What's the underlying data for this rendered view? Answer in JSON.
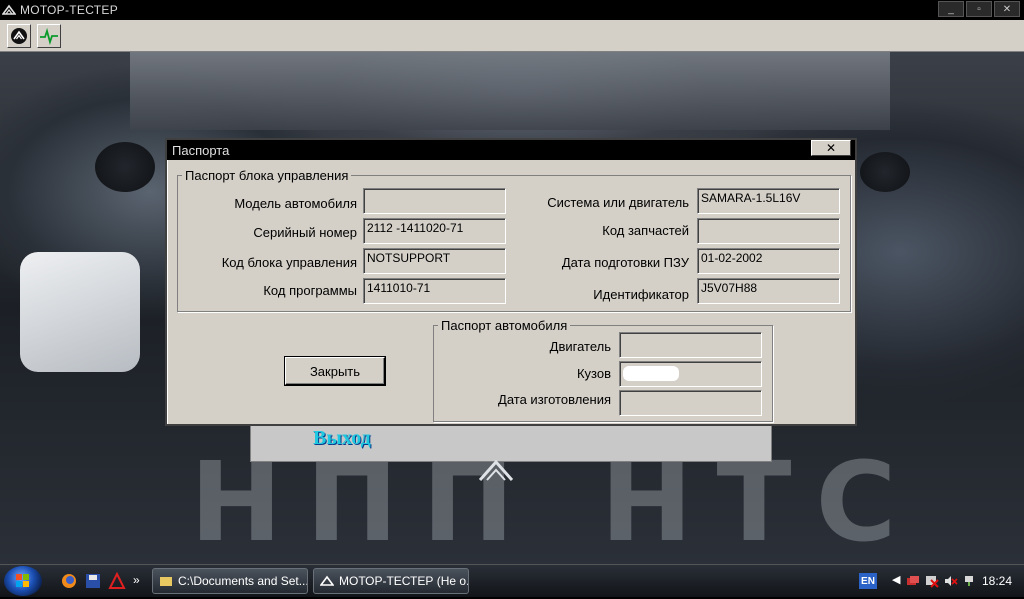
{
  "app": {
    "title": "МОТОР-ТЕСТЕР",
    "window_buttons": [
      "_",
      "▫",
      "✕"
    ]
  },
  "toolbar": {
    "buttons": [
      {
        "icon": "logo-icon"
      },
      {
        "icon": "waveform-icon"
      }
    ]
  },
  "background": {
    "exit_label": "Выход",
    "watermark": "НПП НТС"
  },
  "dialog": {
    "title": "Паспорта",
    "close_symbol": "✕",
    "ecu_group": {
      "title": "Паспорт блока управления",
      "left": [
        {
          "label": "Модель автомобиля",
          "value": ""
        },
        {
          "label": "Серийный номер",
          "value": "2112 -1411020-71"
        },
        {
          "label": "Код блока управления",
          "value": "NOTSUPPORT"
        },
        {
          "label": "Код программы",
          "value": "1411010-71"
        }
      ],
      "right": [
        {
          "label": "Система или двигатель",
          "value": "SAMARA-1.5L16V"
        },
        {
          "label": "Код запчастей",
          "value": ""
        },
        {
          "label": "Дата подготовки ПЗУ",
          "value": "01-02-2002"
        },
        {
          "label": "Идентификатор",
          "value": "J5V07H88"
        }
      ]
    },
    "car_group": {
      "title": "Паспорт автомобиля",
      "fields": [
        {
          "label": "Двигатель",
          "value": ""
        },
        {
          "label": "Кузов",
          "value": ""
        },
        {
          "label": "Дата изготовления",
          "value": ""
        }
      ]
    },
    "close_button": "Закрыть"
  },
  "taskbar": {
    "tasks": [
      {
        "label": "C:\\Documents and Set..."
      },
      {
        "label": "МОТОР-ТЕСТЕР (Не о..."
      }
    ],
    "language": "EN",
    "clock": "18:24"
  },
  "colors": {
    "dialog_bg": "#d4d0c8",
    "title_bg": "#000000",
    "exit_link": "#1ec8e0"
  }
}
